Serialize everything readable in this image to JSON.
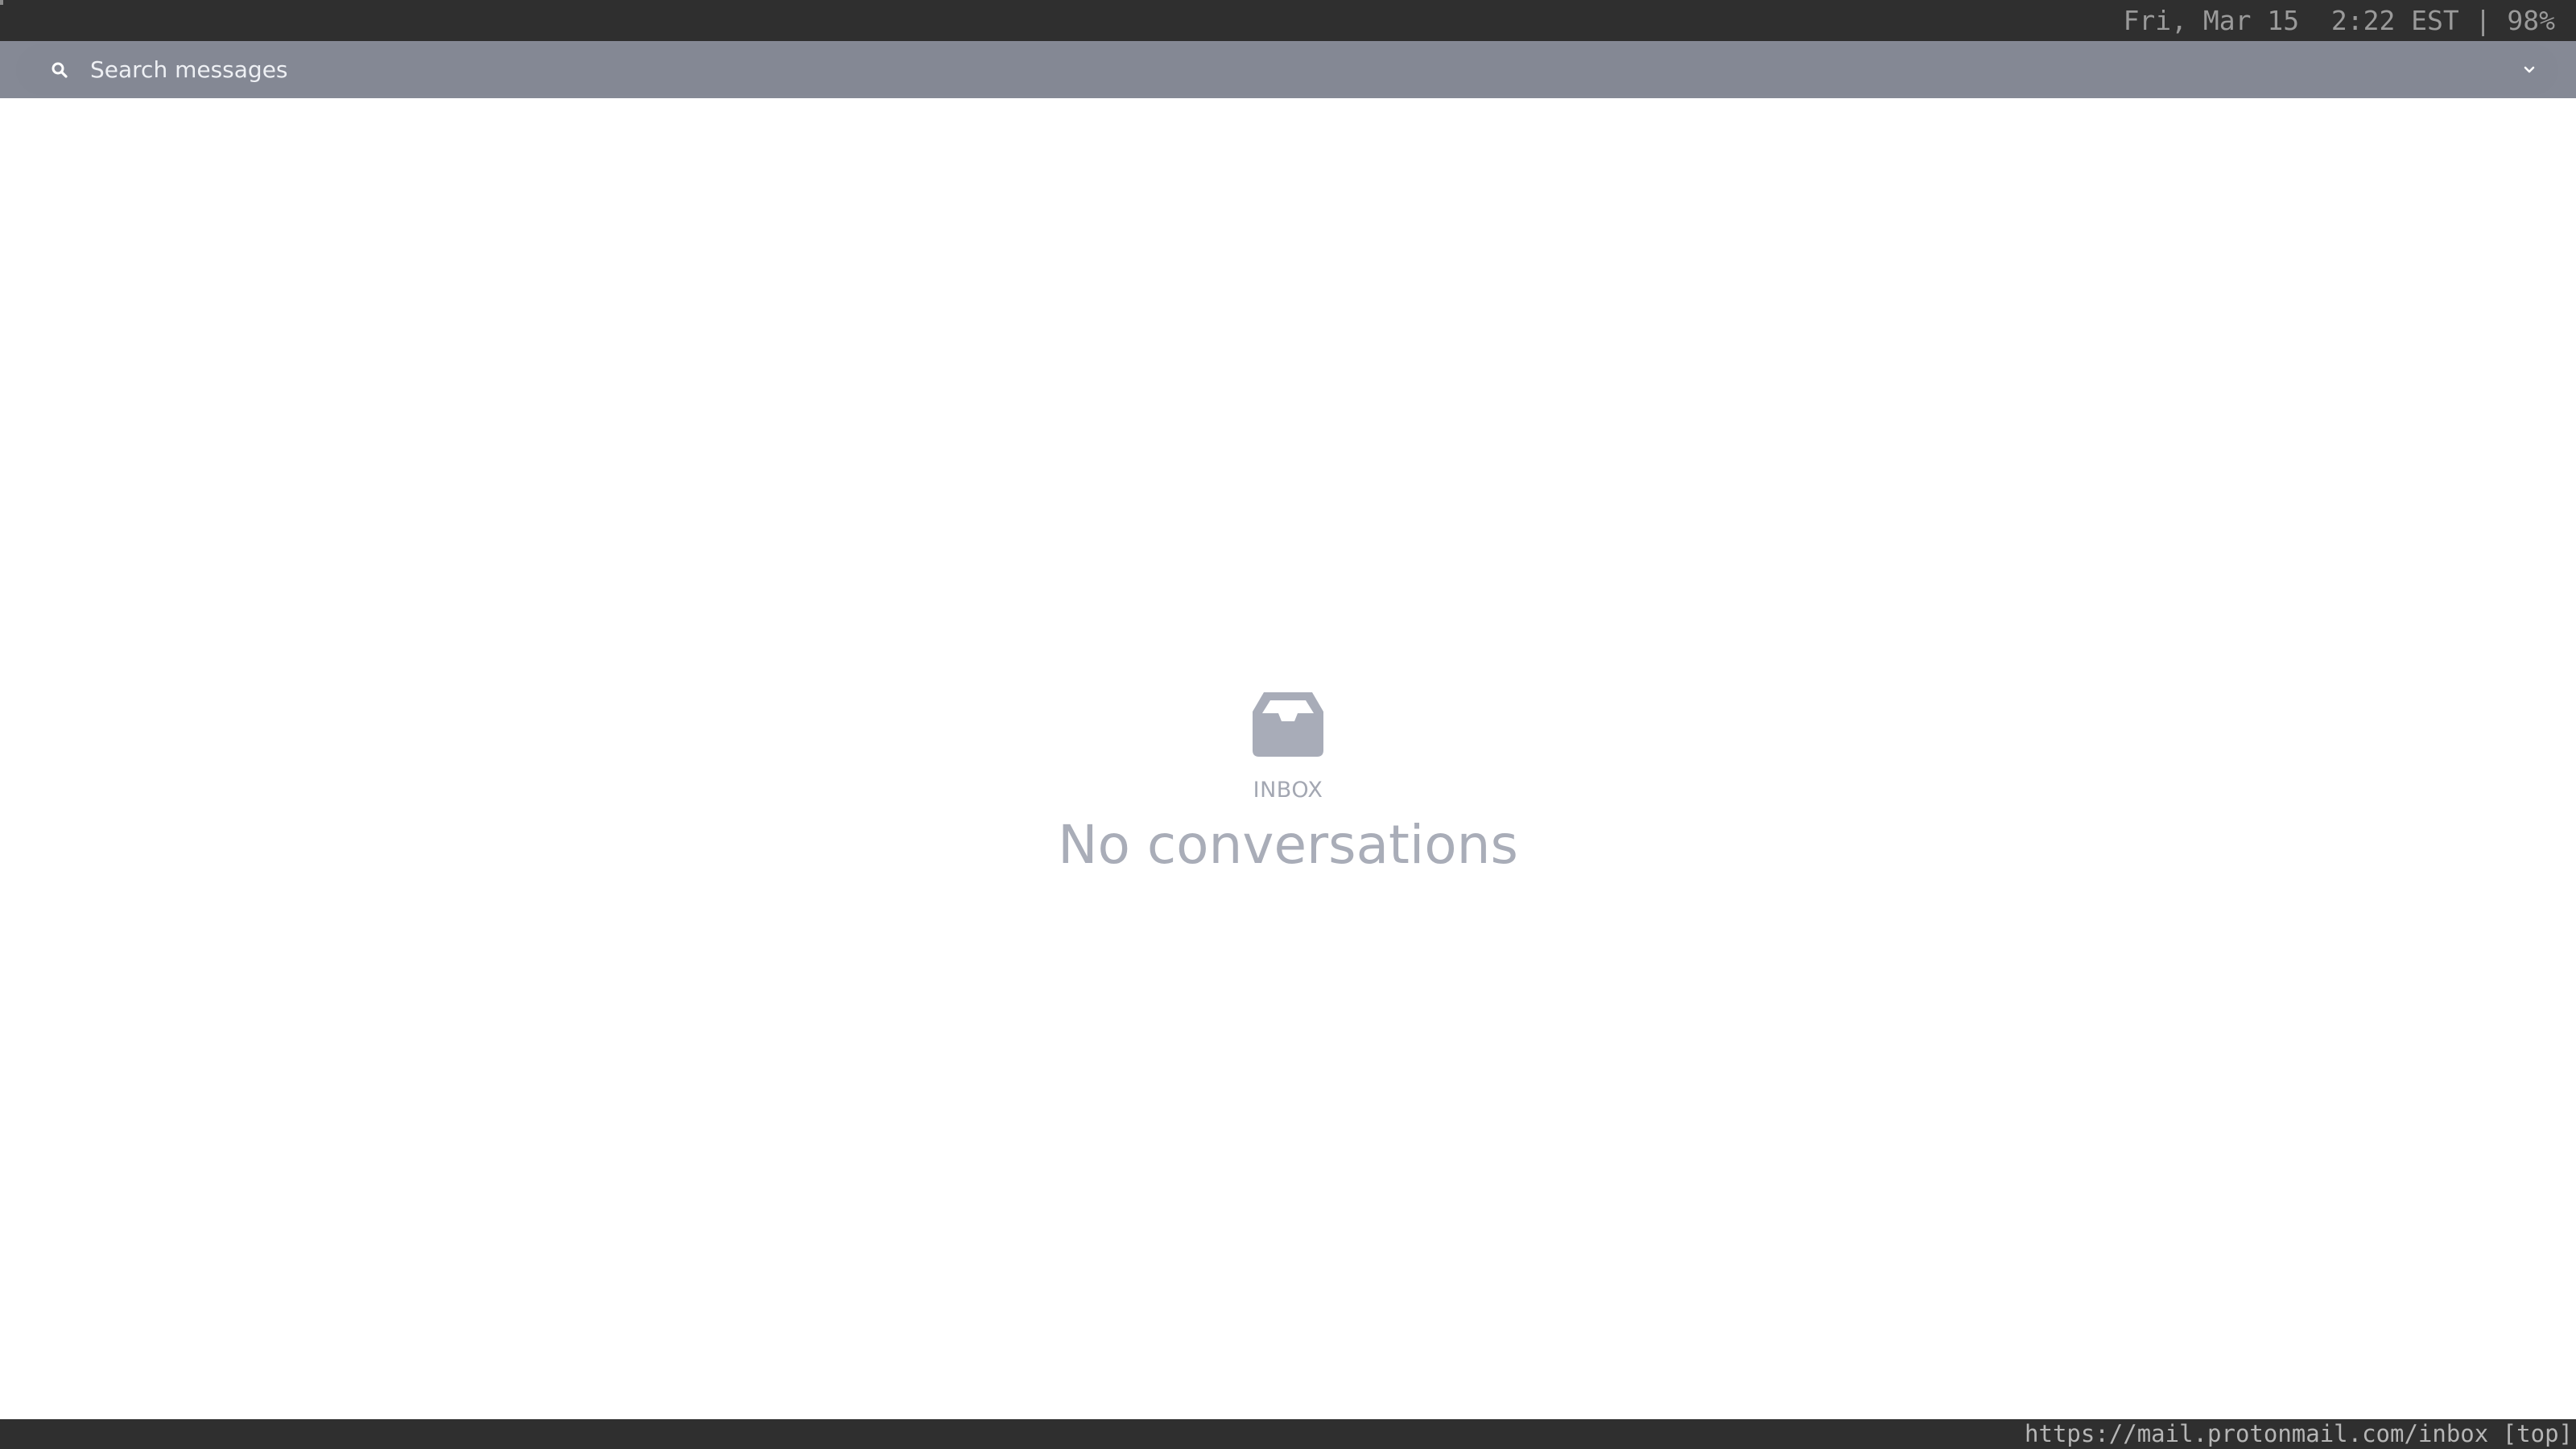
{
  "status_bar": {
    "datetime_battery": "Fri, Mar 15  2:22 EST | 98%"
  },
  "search": {
    "placeholder": "Search messages",
    "value": ""
  },
  "icons": {
    "search": "search-icon",
    "advanced_search_toggle": "chevron-down-icon",
    "empty_inbox": "inbox-tray-icon"
  },
  "empty_state": {
    "folder_label": "INBOX",
    "title": "No conversations"
  },
  "browser_status": {
    "url": "https://mail.protonmail.com/inbox",
    "scroll_position": "[top]"
  },
  "colors": {
    "bars_background": "#2f2f2f",
    "search_strip": "#858995",
    "empty_state_text": "#a9adb8",
    "inbox_icon": "#a8acb8"
  }
}
